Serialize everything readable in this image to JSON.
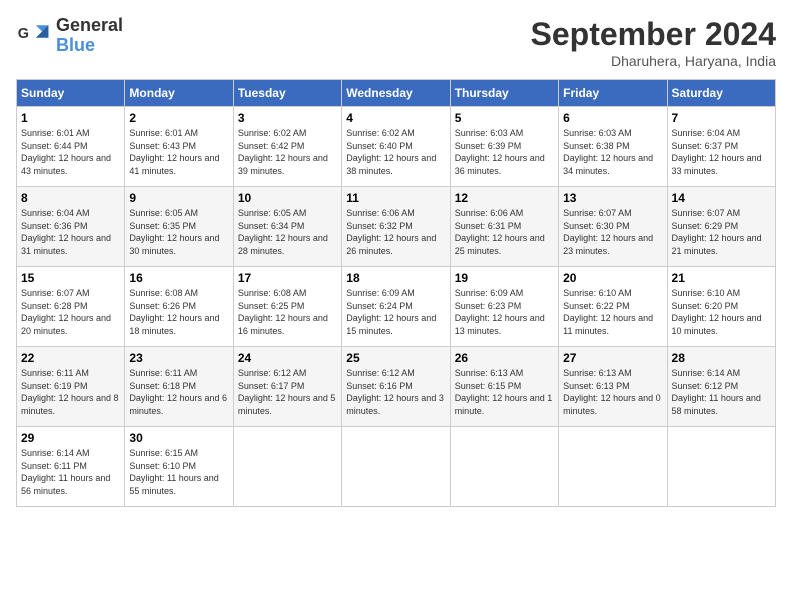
{
  "logo": {
    "text_general": "General",
    "text_blue": "Blue"
  },
  "title": "September 2024",
  "location": "Dharuhera, Haryana, India",
  "days_header": [
    "Sunday",
    "Monday",
    "Tuesday",
    "Wednesday",
    "Thursday",
    "Friday",
    "Saturday"
  ],
  "weeks": [
    [
      {
        "num": "1",
        "sunrise": "6:01 AM",
        "sunset": "6:44 PM",
        "daylight": "12 hours and 43 minutes."
      },
      {
        "num": "2",
        "sunrise": "6:01 AM",
        "sunset": "6:43 PM",
        "daylight": "12 hours and 41 minutes."
      },
      {
        "num": "3",
        "sunrise": "6:02 AM",
        "sunset": "6:42 PM",
        "daylight": "12 hours and 39 minutes."
      },
      {
        "num": "4",
        "sunrise": "6:02 AM",
        "sunset": "6:40 PM",
        "daylight": "12 hours and 38 minutes."
      },
      {
        "num": "5",
        "sunrise": "6:03 AM",
        "sunset": "6:39 PM",
        "daylight": "12 hours and 36 minutes."
      },
      {
        "num": "6",
        "sunrise": "6:03 AM",
        "sunset": "6:38 PM",
        "daylight": "12 hours and 34 minutes."
      },
      {
        "num": "7",
        "sunrise": "6:04 AM",
        "sunset": "6:37 PM",
        "daylight": "12 hours and 33 minutes."
      }
    ],
    [
      {
        "num": "8",
        "sunrise": "6:04 AM",
        "sunset": "6:36 PM",
        "daylight": "12 hours and 31 minutes."
      },
      {
        "num": "9",
        "sunrise": "6:05 AM",
        "sunset": "6:35 PM",
        "daylight": "12 hours and 30 minutes."
      },
      {
        "num": "10",
        "sunrise": "6:05 AM",
        "sunset": "6:34 PM",
        "daylight": "12 hours and 28 minutes."
      },
      {
        "num": "11",
        "sunrise": "6:06 AM",
        "sunset": "6:32 PM",
        "daylight": "12 hours and 26 minutes."
      },
      {
        "num": "12",
        "sunrise": "6:06 AM",
        "sunset": "6:31 PM",
        "daylight": "12 hours and 25 minutes."
      },
      {
        "num": "13",
        "sunrise": "6:07 AM",
        "sunset": "6:30 PM",
        "daylight": "12 hours and 23 minutes."
      },
      {
        "num": "14",
        "sunrise": "6:07 AM",
        "sunset": "6:29 PM",
        "daylight": "12 hours and 21 minutes."
      }
    ],
    [
      {
        "num": "15",
        "sunrise": "6:07 AM",
        "sunset": "6:28 PM",
        "daylight": "12 hours and 20 minutes."
      },
      {
        "num": "16",
        "sunrise": "6:08 AM",
        "sunset": "6:26 PM",
        "daylight": "12 hours and 18 minutes."
      },
      {
        "num": "17",
        "sunrise": "6:08 AM",
        "sunset": "6:25 PM",
        "daylight": "12 hours and 16 minutes."
      },
      {
        "num": "18",
        "sunrise": "6:09 AM",
        "sunset": "6:24 PM",
        "daylight": "12 hours and 15 minutes."
      },
      {
        "num": "19",
        "sunrise": "6:09 AM",
        "sunset": "6:23 PM",
        "daylight": "12 hours and 13 minutes."
      },
      {
        "num": "20",
        "sunrise": "6:10 AM",
        "sunset": "6:22 PM",
        "daylight": "12 hours and 11 minutes."
      },
      {
        "num": "21",
        "sunrise": "6:10 AM",
        "sunset": "6:20 PM",
        "daylight": "12 hours and 10 minutes."
      }
    ],
    [
      {
        "num": "22",
        "sunrise": "6:11 AM",
        "sunset": "6:19 PM",
        "daylight": "12 hours and 8 minutes."
      },
      {
        "num": "23",
        "sunrise": "6:11 AM",
        "sunset": "6:18 PM",
        "daylight": "12 hours and 6 minutes."
      },
      {
        "num": "24",
        "sunrise": "6:12 AM",
        "sunset": "6:17 PM",
        "daylight": "12 hours and 5 minutes."
      },
      {
        "num": "25",
        "sunrise": "6:12 AM",
        "sunset": "6:16 PM",
        "daylight": "12 hours and 3 minutes."
      },
      {
        "num": "26",
        "sunrise": "6:13 AM",
        "sunset": "6:15 PM",
        "daylight": "12 hours and 1 minute."
      },
      {
        "num": "27",
        "sunrise": "6:13 AM",
        "sunset": "6:13 PM",
        "daylight": "12 hours and 0 minutes."
      },
      {
        "num": "28",
        "sunrise": "6:14 AM",
        "sunset": "6:12 PM",
        "daylight": "11 hours and 58 minutes."
      }
    ],
    [
      {
        "num": "29",
        "sunrise": "6:14 AM",
        "sunset": "6:11 PM",
        "daylight": "11 hours and 56 minutes."
      },
      {
        "num": "30",
        "sunrise": "6:15 AM",
        "sunset": "6:10 PM",
        "daylight": "11 hours and 55 minutes."
      },
      null,
      null,
      null,
      null,
      null
    ]
  ]
}
